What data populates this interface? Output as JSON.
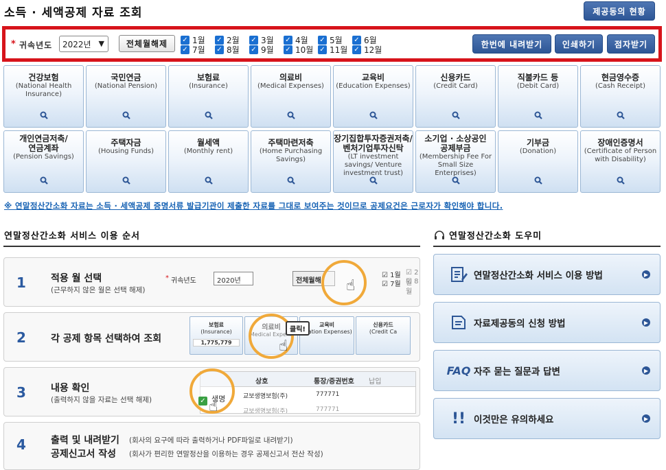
{
  "page": {
    "title": "소득 · 세액공제 자료 조회"
  },
  "top": {
    "status_button": "제공동의 현황"
  },
  "filter": {
    "required_mark": "*",
    "year_label": "귀속년도",
    "year_value": "2022년",
    "clear_all": "전체월해제",
    "months_row1": [
      "1월",
      "2월",
      "3월",
      "4월",
      "5월",
      "6월"
    ],
    "months_row2": [
      "7월",
      "8월",
      "9월",
      "10월",
      "11월",
      "12월"
    ],
    "download_all": "한번에 내려받기",
    "print": "인쇄하기",
    "esign": "점자받기"
  },
  "categories": [
    {
      "ko": "건강보험",
      "en": "(National Health Insurance)"
    },
    {
      "ko": "국민연금",
      "en": "(National Pension)"
    },
    {
      "ko": "보험료",
      "en": "(Insurance)"
    },
    {
      "ko": "의료비",
      "en": "(Medical Expenses)"
    },
    {
      "ko": "교육비",
      "en": "(Education Expenses)"
    },
    {
      "ko": "신용카드",
      "en": "(Credit Card)"
    },
    {
      "ko": "직불카드 등",
      "en": "(Debit Card)"
    },
    {
      "ko": "현금영수증",
      "en": "(Cash Receipt)"
    },
    {
      "ko": "개인연금저축/\n연금계좌",
      "en": "(Pension Savings)"
    },
    {
      "ko": "주택자금",
      "en": "(Housing Funds)"
    },
    {
      "ko": "월세액",
      "en": "(Monthly rent)"
    },
    {
      "ko": "주택마련저축",
      "en": "(Home Purchasing Savings)"
    },
    {
      "ko": "장기집합투자증권저축/\n벤처기업투자신탁",
      "en": "(LT investment savings/ Venture investment trust)"
    },
    {
      "ko": "소기업 · 소상공인\n공제부금",
      "en": "(Membership Fee For Small Size Enterprises)"
    },
    {
      "ko": "기부금",
      "en": "(Donation)"
    },
    {
      "ko": "장애인증명서",
      "en": "(Certificate of Person with Disability)"
    }
  ],
  "notice": "※ 연말정산간소화 자료는 소득 · 세액공제 증명서류 발급기관이 제출한 자료를 그대로 보여주는 것이므로 공제요건은 근로자가 확인해야 합니다.",
  "steps_section": {
    "title": "연말정산간소화 서비스 이용 순서",
    "steps": [
      {
        "num": "1",
        "title": "적용 월 선택",
        "sub": "(근무하지 않은 월은 선택 해제)"
      },
      {
        "num": "2",
        "title": "각 공제 항목 선택하여 조회",
        "sub": ""
      },
      {
        "num": "3",
        "title": "내용 확인",
        "sub": "(출력하지 않을 자료는 선택 해제)"
      },
      {
        "num": "4",
        "title": "출력 및 내려받기",
        "sub": "(회사의 요구에 따라 출력하거나 PDF파일로 내려받기)",
        "title2": "공제신고서 작성",
        "sub2": "(회사가 편리한 연말정산을 이용하는 경우 공제신고서 전산 작성)"
      }
    ],
    "illus1": {
      "year_label": "귀속년도",
      "year_value": "2020년",
      "clear": "전체월해",
      "m1": "1월",
      "m2": "2월",
      "m7": "7월",
      "m8": "8월"
    },
    "illus2": {
      "c1": "보험료",
      "c1en": "(Insurance)",
      "c1val": "1,775,779",
      "c2": "의료비",
      "c2en": "Medical Expens",
      "c3": "교육비",
      "c3en": "ucation Expenses)",
      "c4": "신용카드",
      "c4en": "(Credit Ca",
      "tooltip": "클릭!"
    },
    "illus3": {
      "h1": "상호",
      "h2": "통장/증권번호",
      "h3": "납입",
      "r1": "생명",
      "r1b": "교보생명보험(주)",
      "r1c": "777771",
      "r2b": "교보생명보험(주)",
      "r2c": "777771"
    }
  },
  "help_section": {
    "title": "연말정산간소화 도우미",
    "items": [
      {
        "label": "연말정산간소화 서비스 이용 방법",
        "icon": "edit-doc-icon"
      },
      {
        "label": "자료제공동의 신청 방법",
        "icon": "doc-icon"
      },
      {
        "label": "자주 묻는 질문과 답변",
        "icon": "faq-icon",
        "prefix": "FAQ"
      },
      {
        "label": "이것만은 유의하세요",
        "icon": "warning-icon",
        "prefix": "!!"
      }
    ]
  },
  "colors": {
    "accent": "#2d5696",
    "alert": "#d7141b",
    "notice": "#1561b3"
  }
}
